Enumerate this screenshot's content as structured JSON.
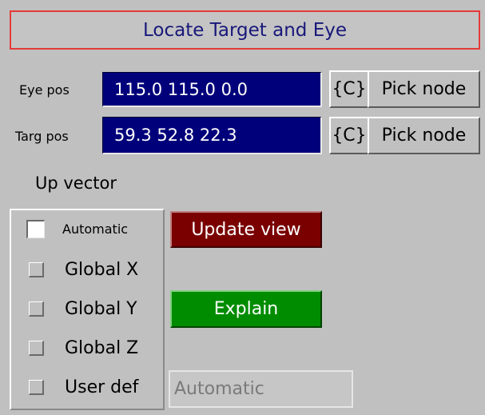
{
  "window": {
    "title": "Locate Target and Eye"
  },
  "eye": {
    "label": "Eye pos",
    "value": "115.0 115.0 0.0",
    "c_label": "{C}",
    "pick_label": "Pick node"
  },
  "target": {
    "label": "Targ pos",
    "value": "59.3 52.8 22.3",
    "c_label": "{C}",
    "pick_label": "Pick node"
  },
  "up_vector": {
    "label": "Up vector",
    "options": [
      {
        "label": "Automatic",
        "checked": true
      },
      {
        "label": "Global X",
        "checked": false
      },
      {
        "label": "Global Y",
        "checked": false
      },
      {
        "label": "Global Z",
        "checked": false
      },
      {
        "label": "User def",
        "checked": false
      }
    ],
    "user_def_value": "Automatic"
  },
  "buttons": {
    "update_view": "Update view",
    "explain": "Explain"
  },
  "colors": {
    "title_border": "#e63a3a",
    "title_text": "#18187a",
    "field_bg": "#00007a",
    "update_bg": "#7a0000",
    "explain_bg": "#008c00",
    "panel_bg": "#c0c0c0"
  }
}
